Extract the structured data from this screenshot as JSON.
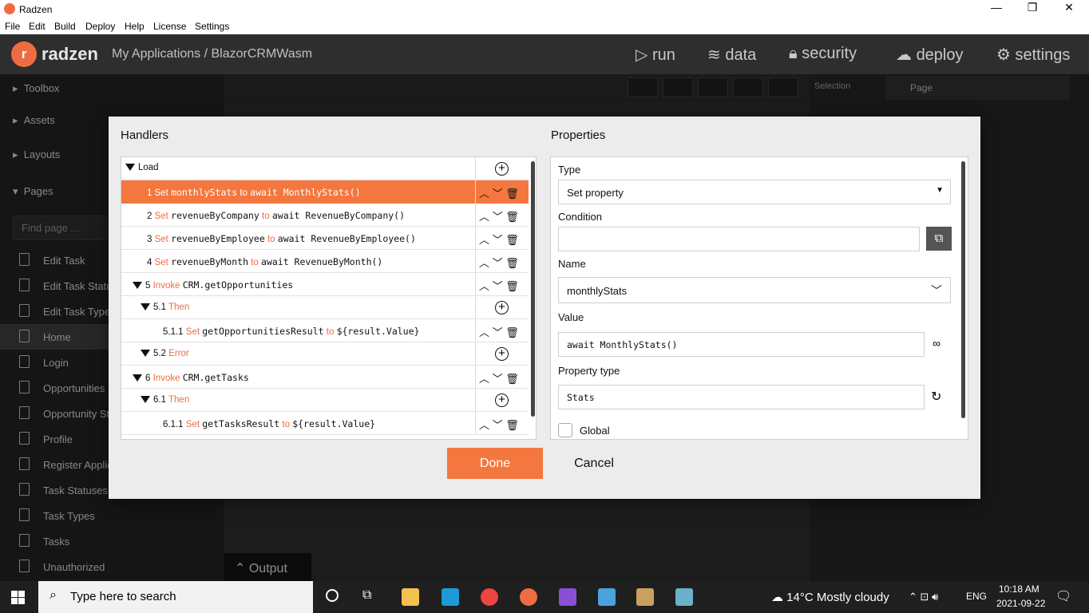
{
  "window": {
    "title": "Radzen",
    "minimize": "—",
    "maximize": "❐",
    "close": "✕"
  },
  "menu": [
    "File",
    "Edit",
    "Build",
    "Deploy",
    "Help",
    "License",
    "Settings"
  ],
  "app": {
    "brand": "radzen",
    "breadcrumb": "My Applications / BlazorCRMWasm",
    "nav": [
      "run",
      "data",
      "security",
      "deploy",
      "settings"
    ]
  },
  "sidebar": {
    "sections": [
      "Toolbox",
      "Assets",
      "Layouts",
      "Pages"
    ],
    "search_placeholder": "Find page ...",
    "pages": [
      "Edit Task",
      "Edit Task Status",
      "Edit Task Type",
      "Home",
      "Login",
      "Opportunities",
      "Opportunity Status",
      "Profile",
      "Register Application User",
      "Task Statuses",
      "Task Types",
      "Tasks",
      "Unauthorized"
    ],
    "selected_page": "Home"
  },
  "right_panel": {
    "selection_label": "Selection",
    "selection_value": "Page"
  },
  "output": {
    "label": "Output"
  },
  "dialog": {
    "handlers_title": "Handlers",
    "properties_title": "Properties",
    "event_name": "Load",
    "rows": [
      {
        "num": "1",
        "kw": "Set",
        "a": "monthlyStats",
        "to": "to",
        "b": "await MonthlyStats()"
      },
      {
        "num": "2",
        "kw": "Set",
        "a": "revenueByCompany",
        "to": "to",
        "b": "await RevenueByCompany()"
      },
      {
        "num": "3",
        "kw": "Set",
        "a": "revenueByEmployee",
        "to": "to",
        "b": "await RevenueByEmployee()"
      },
      {
        "num": "4",
        "kw": "Set",
        "a": "revenueByMonth",
        "to": "to",
        "b": "await RevenueByMonth()"
      },
      {
        "num": "5",
        "kw": "Invoke",
        "a": "CRM.getOpportunities",
        "to": "",
        "b": ""
      },
      {
        "num": "5.1",
        "kw": "Then",
        "a": "",
        "to": "",
        "b": ""
      },
      {
        "num": "5.1.1",
        "kw": "Set",
        "a": "getOpportunitiesResult",
        "to": "to",
        "b": "${result.Value}"
      },
      {
        "num": "5.2",
        "kw": "Error",
        "a": "",
        "to": "",
        "b": ""
      },
      {
        "num": "6",
        "kw": "Invoke",
        "a": "CRM.getTasks",
        "to": "",
        "b": ""
      },
      {
        "num": "6.1",
        "kw": "Then",
        "a": "",
        "to": "",
        "b": ""
      },
      {
        "num": "6.1.1",
        "kw": "Set",
        "a": "getTasksResult",
        "to": "to",
        "b": "${result.Value}"
      }
    ],
    "props": {
      "type_label": "Type",
      "type_value": "Set property",
      "condition_label": "Condition",
      "condition_value": "",
      "name_label": "Name",
      "name_value": "monthlyStats",
      "value_label": "Value",
      "value_value": "await MonthlyStats()",
      "ptype_label": "Property type",
      "ptype_value": "Stats",
      "global_label": "Global"
    },
    "done": "Done",
    "cancel": "Cancel"
  },
  "taskbar": {
    "search_placeholder": "Type here to search",
    "weather": "14°C  Mostly cloudy",
    "lang": "ENG",
    "time": "10:18 AM",
    "date": "2021-09-22"
  },
  "colors": {
    "accent": "#f4773f",
    "bg": "#2b2b2b"
  }
}
